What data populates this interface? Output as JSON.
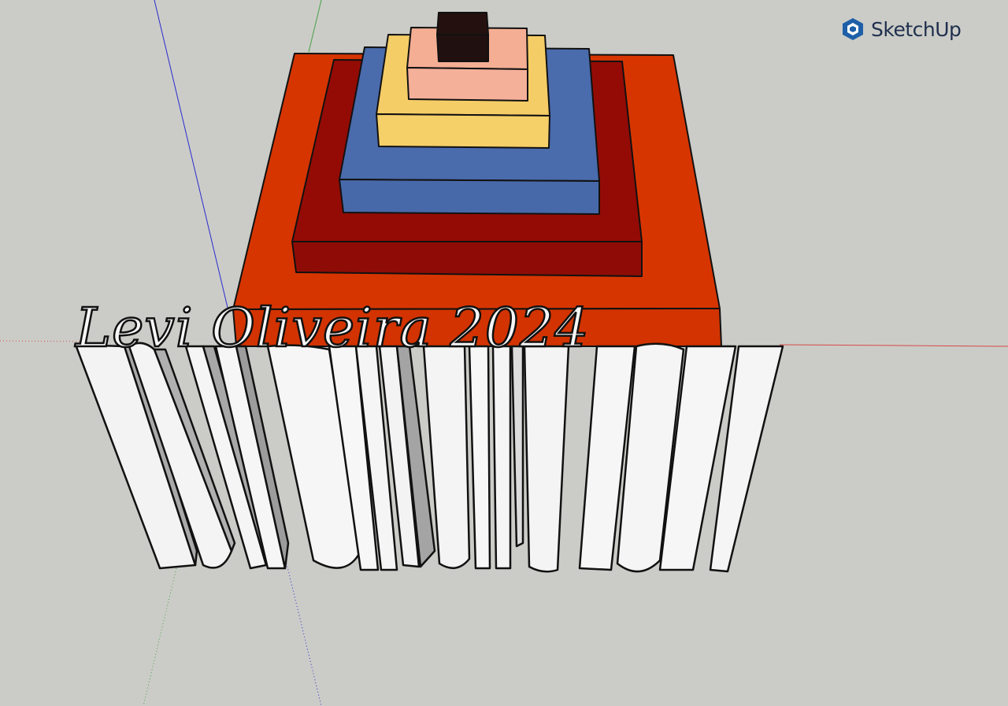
{
  "app": {
    "brand_name": "SketchUp",
    "brand_color": "#1f5fa8",
    "logo_icon": "sketchup-logo-icon"
  },
  "viewport": {
    "background_color": "#cbccc7",
    "axes": {
      "x_axis_color": "#d84848",
      "y_axis_color": "#46a046",
      "z_axis_color": "#2a2ad0"
    }
  },
  "model": {
    "pyramid_layers": [
      {
        "name": "base",
        "color": "#d73500"
      },
      {
        "name": "second",
        "color": "#940b05"
      },
      {
        "name": "third",
        "color": "#4a6bac"
      },
      {
        "name": "fourth",
        "color": "#f5cd66"
      },
      {
        "name": "fifth",
        "color": "#f4ae94"
      },
      {
        "name": "top-cube",
        "color": "#24110f"
      }
    ],
    "extruded_text": "Levi Oliveira 2024",
    "extruded_text_color": "#f5f5f5"
  }
}
